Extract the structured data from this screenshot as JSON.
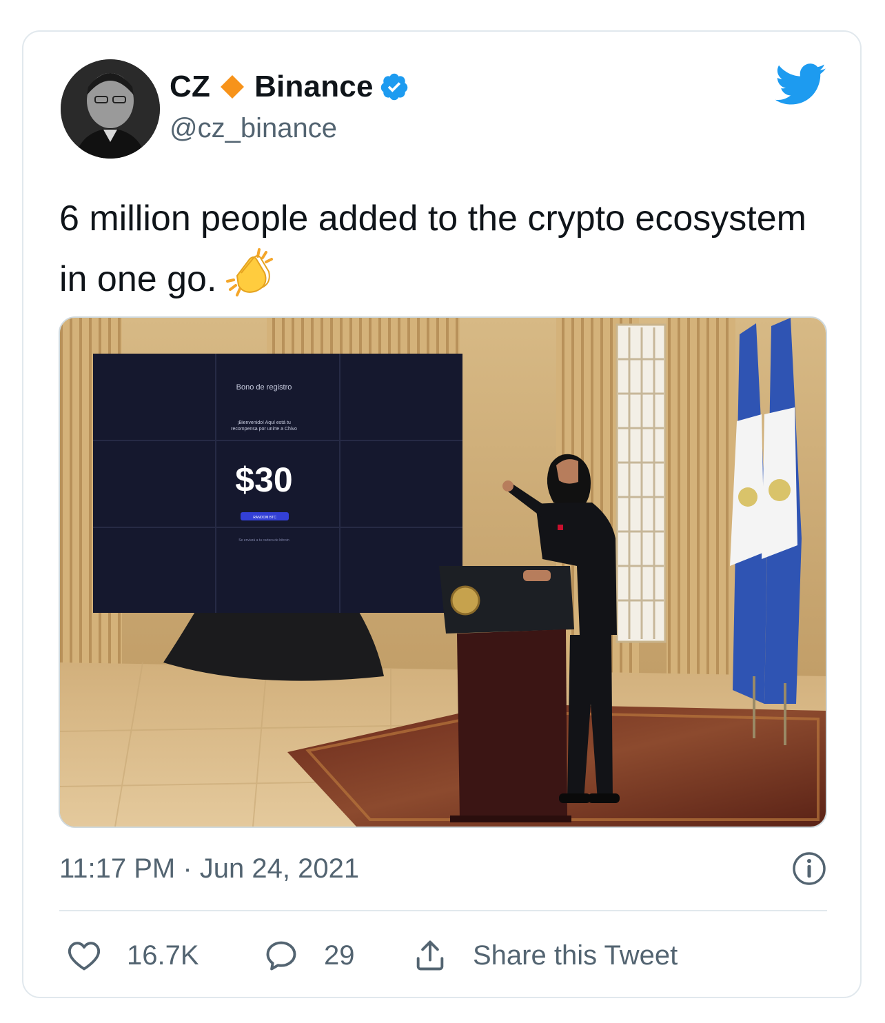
{
  "author": {
    "display_name_part1": "CZ",
    "display_name_part2": "Binance",
    "handle": "@cz_binance"
  },
  "tweet": {
    "text": "6 million people added to the crypto ecosystem in one go.",
    "emoji_icon": "clapping-hands"
  },
  "media": {
    "screen_title": "Bono de registro",
    "screen_subtitle_line1": "¡Bienvenido! Aquí está tu",
    "screen_subtitle_line2": "recompensa por unirte a Chivo",
    "screen_amount": "$30",
    "screen_button": "RANDOM BTC",
    "screen_footer": "Se enviará a tu cartera de bitcoin"
  },
  "meta": {
    "timestamp": "11:17 PM · Jun 24, 2021"
  },
  "actions": {
    "likes": "16.7K",
    "replies": "29",
    "share_label": "Share this Tweet"
  },
  "colors": {
    "twitter_blue": "#1d9bf0",
    "binance_orange": "#f7931a",
    "muted_text": "#536471",
    "border": "#e1e8ed"
  }
}
